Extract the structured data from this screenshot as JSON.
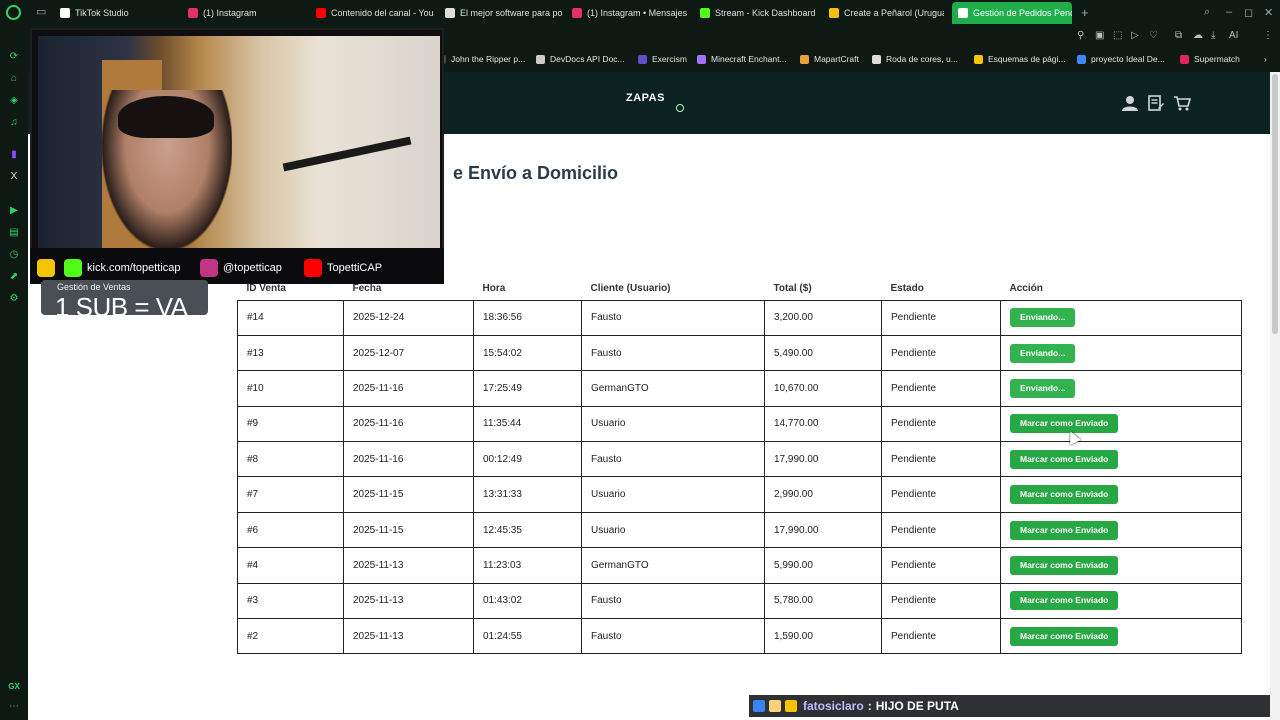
{
  "browser": {
    "tabs": [
      {
        "label": "TikTok Studio",
        "color": "#ffffff"
      },
      {
        "label": "(1) Instagram",
        "color": "#e1306c"
      },
      {
        "label": "Contenido del canal - You",
        "color": "#ff0000"
      },
      {
        "label": "El mejor software para po",
        "color": "#dddddd"
      },
      {
        "label": "(1) Instagram • Mensajes",
        "color": "#e1306c"
      },
      {
        "label": "Stream - Kick Dashboard",
        "color": "#53fc18"
      },
      {
        "label": "Create a Peñarol (Uruguay",
        "color": "#f4c20d"
      },
      {
        "label": "Gestión de Pedidos Pendi",
        "color": "#ffffff",
        "active": true
      }
    ],
    "new_tab_label": "+",
    "toolbar_label": "AI",
    "bookmarks": [
      {
        "label": "John the Ripper p...",
        "color": "#444444"
      },
      {
        "label": "DevDocs API Doc...",
        "color": "#cccccc"
      },
      {
        "label": "Exercism",
        "color": "#604fcd"
      },
      {
        "label": "Minecraft Enchant...",
        "color": "#a070ff"
      },
      {
        "label": "MapartCraft",
        "color": "#e8a23a"
      },
      {
        "label": "Roda de cores, u...",
        "color": "#dddddd"
      },
      {
        "label": "Esquemas de pági...",
        "color": "#f7c400"
      },
      {
        "label": "proyecto Ideal De...",
        "color": "#4285f4"
      },
      {
        "label": "Supermatch",
        "color": "#e0245e"
      }
    ]
  },
  "site": {
    "brand": "ZAPAS",
    "page_title": "e Envío a Domicilio"
  },
  "table": {
    "headers": [
      "ID Venta",
      "Fecha",
      "Hora",
      "Cliente (Usuario)",
      "Total ($)",
      "Estado",
      "Acción"
    ],
    "rows": [
      {
        "id": "#14",
        "fecha": "2025-12-24",
        "hora": "18:36:56",
        "cliente": "Fausto",
        "total": "3,200.00",
        "estado": "Pendiente",
        "accion": "Enviando...",
        "sending": true
      },
      {
        "id": "#13",
        "fecha": "2025-12-07",
        "hora": "15:54:02",
        "cliente": "Fausto",
        "total": "5,490.00",
        "estado": "Pendiente",
        "accion": "Enviando...",
        "sending": true
      },
      {
        "id": "#10",
        "fecha": "2025-11-16",
        "hora": "17:25:49",
        "cliente": "GermanGTO",
        "total": "10,670.00",
        "estado": "Pendiente",
        "accion": "Enviando...",
        "sending": true
      },
      {
        "id": "#9",
        "fecha": "2025-11-16",
        "hora": "11:35:44",
        "cliente": "Usuario",
        "total": "14,770.00",
        "estado": "Pendiente",
        "accion": "Marcar como Enviado",
        "sending": false
      },
      {
        "id": "#8",
        "fecha": "2025-11-16",
        "hora": "00:12:49",
        "cliente": "Fausto",
        "total": "17,990.00",
        "estado": "Pendiente",
        "accion": "Marcar como Enviado",
        "sending": false
      },
      {
        "id": "#7",
        "fecha": "2025-11-15",
        "hora": "13:31:33",
        "cliente": "Usuario",
        "total": "2,990.00",
        "estado": "Pendiente",
        "accion": "Marcar como Enviado",
        "sending": false
      },
      {
        "id": "#6",
        "fecha": "2025-11-15",
        "hora": "12:45:35",
        "cliente": "Usuario",
        "total": "17,990.00",
        "estado": "Pendiente",
        "accion": "Marcar como Enviado",
        "sending": false
      },
      {
        "id": "#4",
        "fecha": "2025-11-13",
        "hora": "11:23:03",
        "cliente": "GermanGTO",
        "total": "5,990.00",
        "estado": "Pendiente",
        "accion": "Marcar como Enviado",
        "sending": false
      },
      {
        "id": "#3",
        "fecha": "2025-11-13",
        "hora": "01:43:02",
        "cliente": "Fausto",
        "total": "5,780.00",
        "estado": "Pendiente",
        "accion": "Marcar como Enviado",
        "sending": false
      },
      {
        "id": "#2",
        "fecha": "2025-11-13",
        "hora": "01:24:55",
        "cliente": "Fausto",
        "total": "1,590.00",
        "estado": "Pendiente",
        "accion": "Marcar como Enviado",
        "sending": false
      }
    ]
  },
  "overlay": {
    "sales_panel_label": "Gestión de Ventas",
    "sub_text": "1 SUB = VA",
    "socials": [
      {
        "label": "kick.com/topetticap",
        "icon": "kick-icon",
        "color": "#53fc18"
      },
      {
        "label": "@topetticap",
        "icon": "instagram-icon",
        "color": "#c13584"
      },
      {
        "label": "TopettiCAP",
        "icon": "youtube-icon",
        "color": "#ff0000"
      }
    ],
    "chat": {
      "user": "fatosiclaro",
      "separator": ":",
      "message": "HIJO DE PUTA"
    }
  },
  "colors": {
    "accent_green": "#28a745",
    "header_bg": "#0d2321",
    "browser_bg": "#0d1912"
  }
}
